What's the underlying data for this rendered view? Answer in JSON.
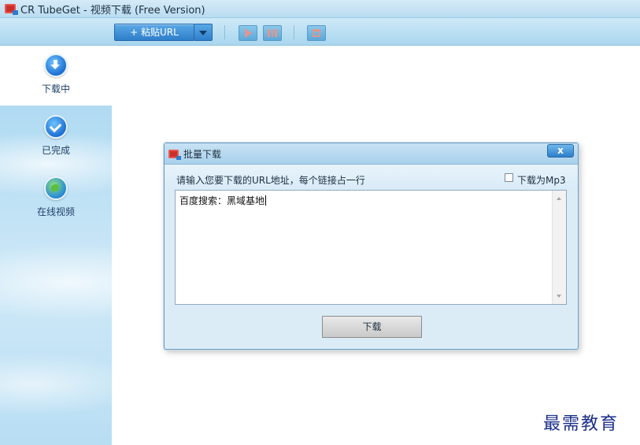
{
  "window": {
    "title": "CR TubeGet - 视频下载 (Free Version)"
  },
  "toolbar": {
    "paste_label": "+ 粘贴URL",
    "icons": [
      "chevron-down-icon",
      "play-icon",
      "pause-icon",
      "delete-icon"
    ]
  },
  "sidebar": {
    "items": [
      {
        "label": "下载中",
        "icon": "download-icon",
        "active": true
      },
      {
        "label": "已完成",
        "icon": "check-icon",
        "active": false
      },
      {
        "label": "在线视频",
        "icon": "globe-icon",
        "active": false
      }
    ]
  },
  "dialog": {
    "title": "批量下载",
    "close_label": "x",
    "prompt": "请输入您要下载的URL地址，每个链接占一行",
    "mp3_label": "下载为Mp3",
    "mp3_checked": false,
    "url_text": "百度搜索：黑域基地",
    "download_label": "下载"
  },
  "watermark": "最需教育",
  "colors": {
    "accent_blue": "#2f7fc9",
    "sidebar_bg": "#bfe2f5",
    "dialog_bg": "#dcecf7"
  }
}
